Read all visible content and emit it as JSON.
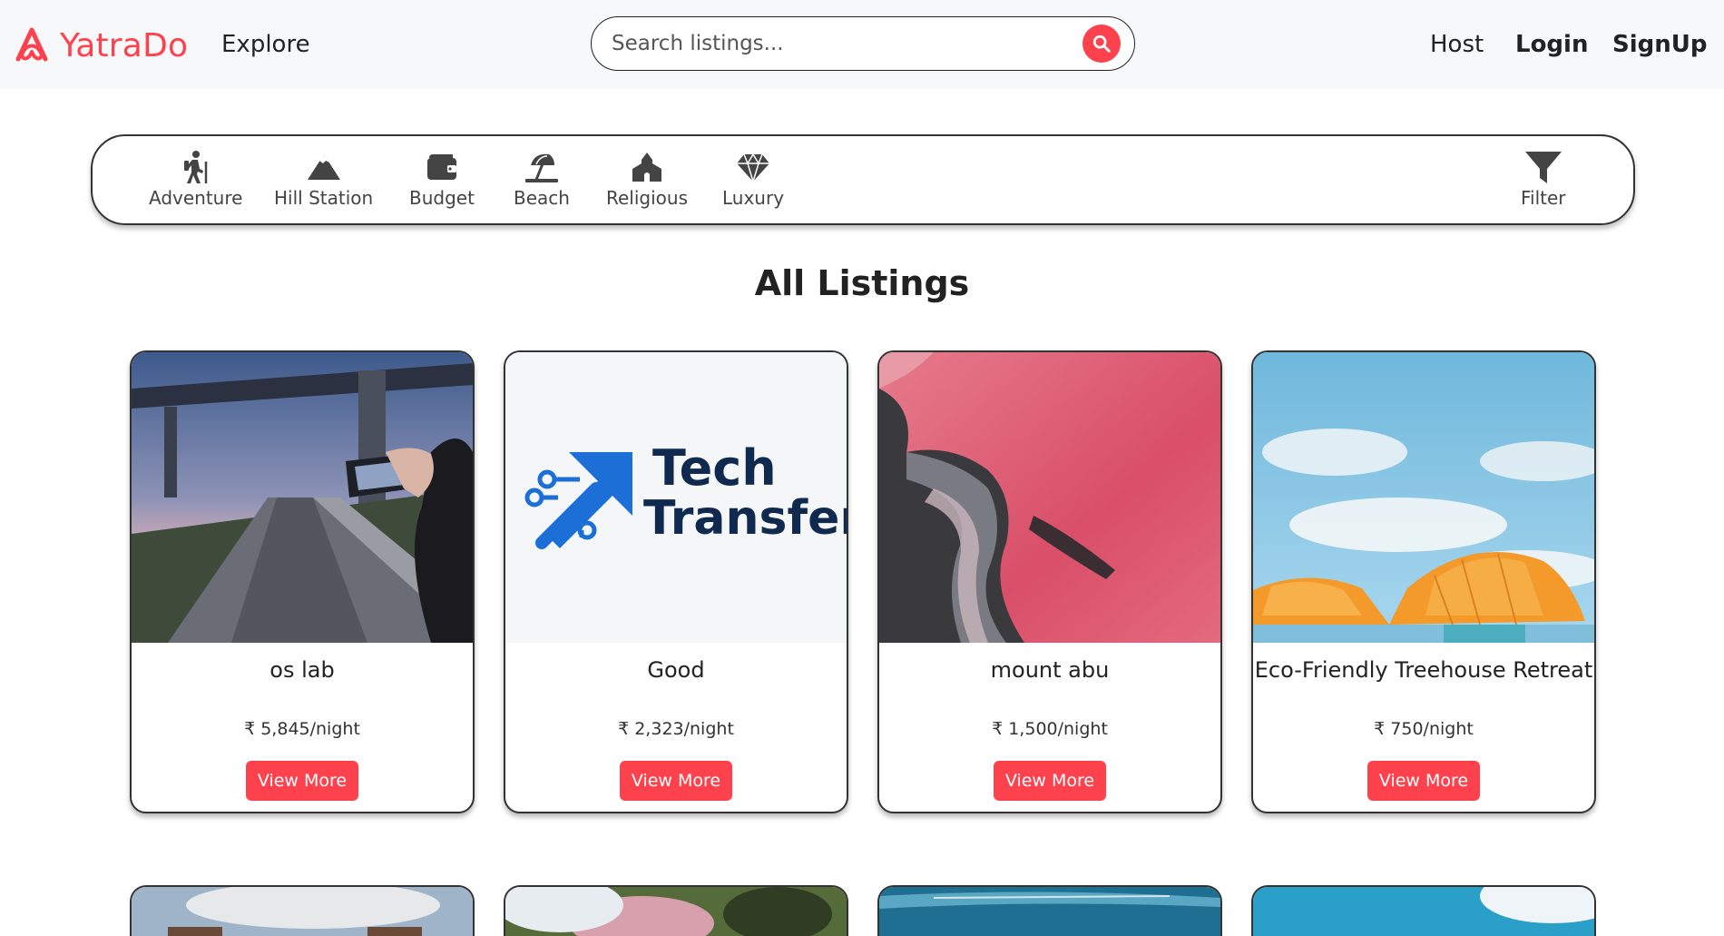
{
  "navbar": {
    "brand": "YatraDo",
    "explore": "Explore",
    "search_placeholder": "Search listings...",
    "host": "Host",
    "login": "Login",
    "signup": "SignUp",
    "accent_color": "#fe424d"
  },
  "categories": [
    {
      "label": "Adventure",
      "icon": "hiking-icon"
    },
    {
      "label": "Hill Station",
      "icon": "mountain-icon"
    },
    {
      "label": "Budget",
      "icon": "wallet-icon"
    },
    {
      "label": "Beach",
      "icon": "umbrella-beach-icon"
    },
    {
      "label": "Religious",
      "icon": "place-of-worship-icon"
    },
    {
      "label": "Luxury",
      "icon": "gem-icon"
    }
  ],
  "filter": {
    "label": "Filter",
    "icon": "filter-icon"
  },
  "page_title": "All Listings",
  "listings": [
    {
      "title": "os lab",
      "price": "₹ 5,845/night",
      "button": "View More",
      "image": "bridge-road-photo"
    },
    {
      "title": "Good",
      "price": "₹ 2,323/night",
      "button": "View More",
      "image": "tech-transfer-logo",
      "image_text_1": "Tech",
      "image_text_2": "Transfer"
    },
    {
      "title": "mount abu",
      "price": "₹ 1,500/night",
      "button": "View More",
      "image": "pink-lake-aerial-photo"
    },
    {
      "title": "Eco-Friendly Treehouse Retreat",
      "price": "₹ 750/night",
      "button": "View More",
      "image": "orange-umbrellas-photo"
    }
  ]
}
